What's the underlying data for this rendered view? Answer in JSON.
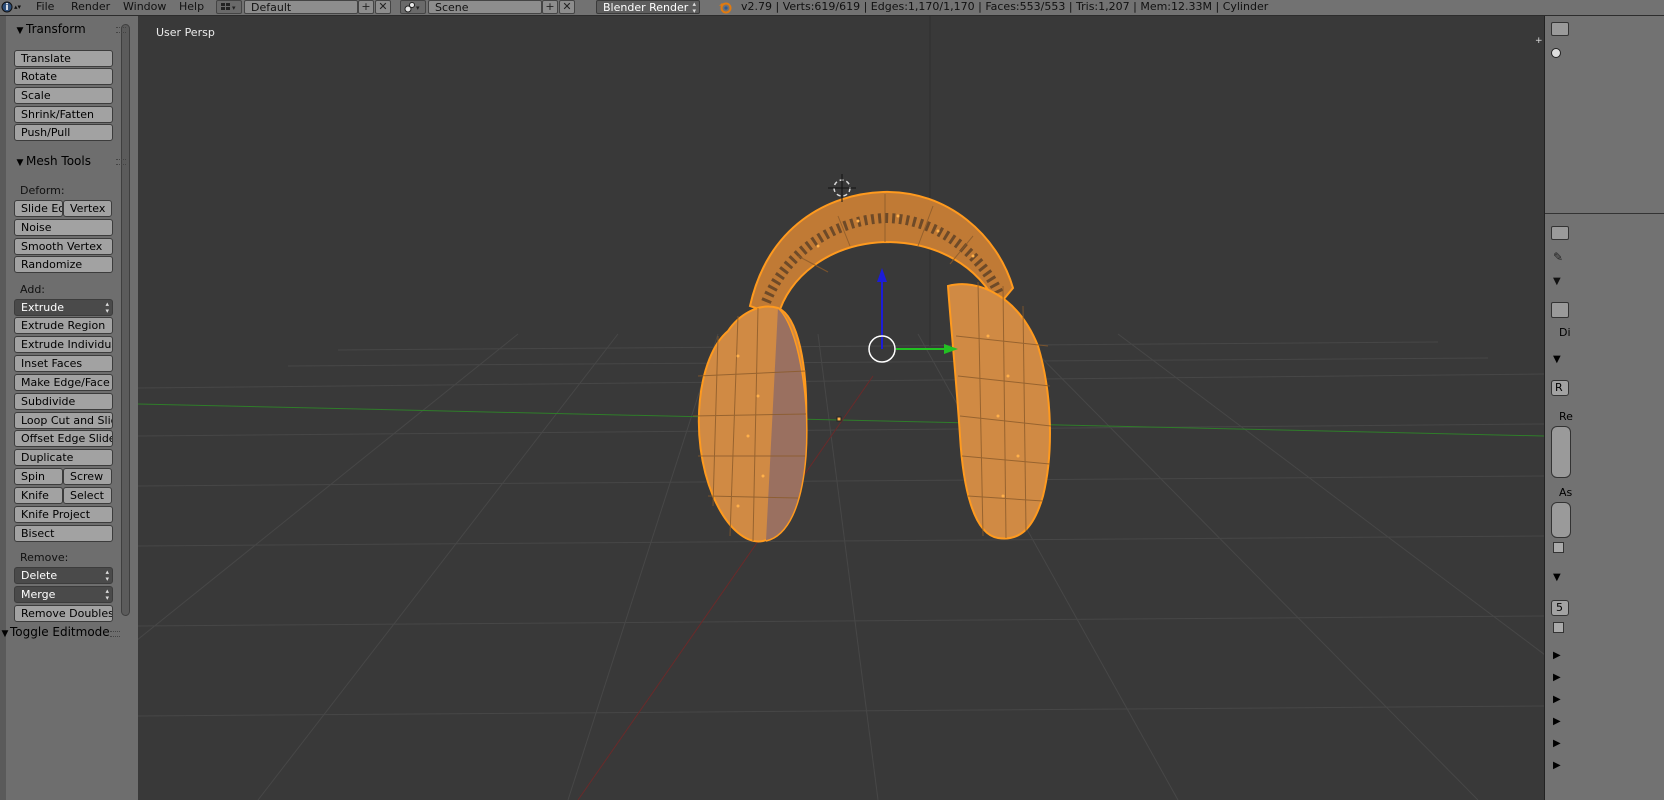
{
  "header": {
    "menus": [
      "File",
      "Render",
      "Window",
      "Help"
    ],
    "layout": "Default",
    "scene": "Scene",
    "engine": "Blender Render",
    "stats": "v2.79 | Verts:619/619 | Edges:1,170/1,170 | Faces:553/553 | Tris:1,207 | Mem:12.33M | Cylinder"
  },
  "toolshelf": {
    "transform": {
      "title": "Transform",
      "buttons": [
        "Translate",
        "Rotate",
        "Scale",
        "Shrink/Fatten",
        "Push/Pull"
      ]
    },
    "mesh_tools": {
      "title": "Mesh Tools",
      "deform_label": "Deform:",
      "deform": [
        "Slide Ed",
        "Vertex",
        "Noise",
        "Smooth Vertex",
        "Randomize"
      ],
      "add_label": "Add:",
      "extrude": "Extrude",
      "add": [
        "Extrude Region",
        "Extrude Individual",
        "Inset Faces",
        "Make Edge/Face",
        "Subdivide",
        "Loop Cut and Slide",
        "Offset Edge Slide",
        "Duplicate",
        "Spin",
        "Screw",
        "Knife",
        "Select",
        "Knife Project",
        "Bisect"
      ],
      "remove_label": "Remove:",
      "remove": [
        "Delete",
        "Merge",
        "Remove Doubles"
      ]
    },
    "toggle_editmode": "Toggle Editmode"
  },
  "viewport": {
    "label": "User Persp"
  },
  "colors": {
    "mesh": "#e99a3c",
    "mesh_dark": "#a8692a",
    "selection": "#ff9a1e",
    "grid": "#4a4a4a",
    "axis_x": "#7a2c2c",
    "axis_y": "#3a8a2a",
    "gizmo_z": "#1c1cd8",
    "gizmo_y": "#22c022"
  },
  "right_panel": {
    "labels": [
      "Di",
      "Re",
      "As",
      "5"
    ]
  }
}
